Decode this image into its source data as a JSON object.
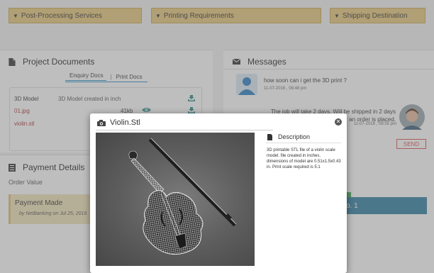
{
  "accordion": [
    {
      "label": "Post-Processing Services"
    },
    {
      "label": "Printing Requirements"
    },
    {
      "label": "Shipping Destination"
    }
  ],
  "project_documents": {
    "title": "Project Documents",
    "tabs": [
      "Enquiry Docs",
      "Print Docs"
    ],
    "tab_separator": "|",
    "rows": [
      {
        "name": "3D Model",
        "detail": "3D Model created in inch",
        "size": ""
      },
      {
        "name": "01.jpg",
        "detail": "",
        "size": "41kb"
      },
      {
        "name": "violin.stl",
        "detail": "",
        "size": ""
      }
    ]
  },
  "payment": {
    "title": "Payment Details",
    "order_value_label": "Order Value",
    "status": "Payment Made",
    "note": "by NetBanking on Jul 25, 2016"
  },
  "messages": {
    "title": "Messages",
    "items": [
      {
        "text": "how soon can i get the 3D print ?",
        "time": "11-07-2016 , 08:48 pm"
      },
      {
        "text": "The job will take 2 days. Will be shipped in 2 days after an order is placed.",
        "time": "11-07-2016 , 08:55 pm"
      }
    ],
    "send_label": "SEND",
    "partial_button": "o. 1"
  },
  "modal": {
    "title": "Violin.Stl",
    "close_glyph": "✕",
    "description_heading": "Description",
    "description": "3D printable STL file of a violin scale model. file created in inches. dimensions of model are 0.51x1.5x0.43 in. Print scale required is 5:1"
  },
  "colors": {
    "accordion_bg": "#e8c87a",
    "send_red": "#d9534f",
    "accent_teal": "#2e7fa0",
    "progress_green": "#3cae52",
    "link_blue": "#2a8fc7"
  }
}
